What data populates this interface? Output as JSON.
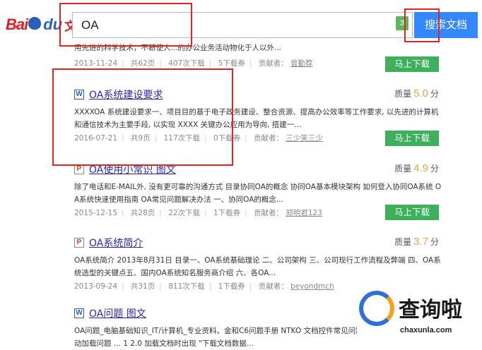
{
  "header": {
    "logo_bai": "Bai",
    "logo_du": "du",
    "logo_wenku": "文库",
    "search_value": "OA",
    "search_badge": "3",
    "search_button": "搜索文档"
  },
  "top_result": {
    "snippet": "用先进的科学技术，不断使人...的办公业务活动物化于人以外...",
    "date": "2013-11-24",
    "pages": "共62页",
    "downloads": "407次下载",
    "coupons": "5下载券",
    "contributor_label": "贡献者：",
    "contributor": "曾勤荐",
    "download_btn": "马上下载"
  },
  "results": [
    {
      "icon": "W",
      "title": "OA系统建设要求",
      "score_label": "质量",
      "score": "5.0",
      "score_unit": "分",
      "desc_line1": "XXXXOA 系统建设要求一、项目目的基于电子政务建设、整合资源、提高办公效率等工作要求, 以先进的计算机",
      "desc_line2": "和通信技术为主要手段, 以实现 XXXX 关键办公应用为导向, 搭建一...",
      "date": "2016-07-21",
      "pages": "共9页",
      "downloads": "117次下载",
      "coupons": "0下载券",
      "contributor_label": "贡献者：",
      "contributor": "三少笑三少",
      "download_btn": "马上下载"
    },
    {
      "icon": "P",
      "title": "OA使用小常识 图文",
      "score_label": "质量",
      "score": "4.9",
      "score_unit": "分",
      "desc_line1": "除了电话和E-MAIL外, 没有更可靠的沟通方式 目录协同OA的概念 协同OA基本模块架构 如何登入协同OA系统 O",
      "desc_line2": "A系统快速使用指南 OA常见问题解决办法 一、协同OA的概念...",
      "date": "2015-12-15",
      "pages": "共28页",
      "downloads": "22次下载",
      "coupons": "1下载券",
      "contributor_label": "贡献者：",
      "contributor": "郑明君123",
      "download_btn": "马上下载"
    },
    {
      "icon": "P",
      "title": "OA系统简介",
      "score_label": "质量",
      "score": "3.7",
      "score_unit": "分",
      "desc_line1": "OA系统简介 2013年8月31日 目录一、OA系统基础理论 二、公司架构 三、公司现行工作流程及弊端 四、OA系",
      "desc_line2": "统选型的关键点五、国内OA系统知名服务商介绍 六、各OA...",
      "date": "2013-09-24",
      "pages": "共31页",
      "downloads": "811次下载",
      "coupons": "1下载券",
      "contributor_label": "贡献者：",
      "contributor": "beyondmch",
      "download_btn": ""
    },
    {
      "icon": "W",
      "title": "OA问题 图文",
      "score_label": "",
      "score": "",
      "score_unit": "",
      "desc_line1": "OA问题_电脑基础知识_IT/计算机_专业资料。金和C6问题手册 NTKO 文档控件常见问题",
      "desc_line2": "动加载问题 ... 1 2.0 加载文档时出现 \"下载文档数据...",
      "date": "",
      "pages": "",
      "downloads": "",
      "coupons": "",
      "contributor_label": "",
      "contributor": "",
      "download_btn": ""
    }
  ],
  "watermark": {
    "text": "查询啦",
    "sub": "chaxunla.com"
  },
  "colors": {
    "brand_red": "#de1c22",
    "brand_blue": "#2b5fbb",
    "search_blue": "#3388ff",
    "download_green": "#3db05c",
    "link": "#2c27a8",
    "highlight_red": "#e02424",
    "score_orange": "#e0a44a"
  }
}
